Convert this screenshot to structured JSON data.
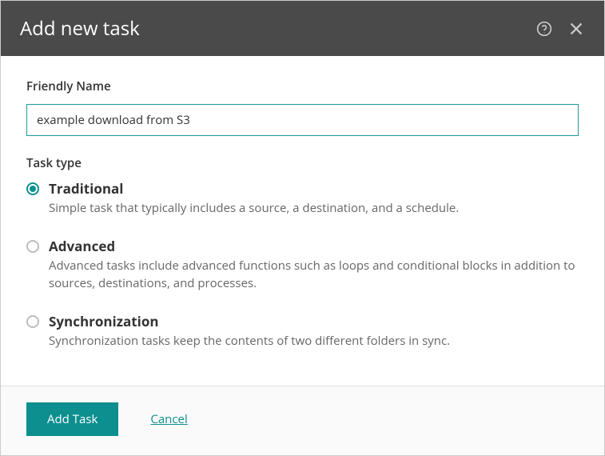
{
  "dialog": {
    "title": "Add new task"
  },
  "form": {
    "friendly_name_label": "Friendly Name",
    "friendly_name_value": "example download from S3",
    "task_type_label": "Task type",
    "options": [
      {
        "title": "Traditional",
        "desc": "Simple task that typically includes a source, a destination, and a schedule.",
        "selected": true
      },
      {
        "title": "Advanced",
        "desc": "Advanced tasks include advanced functions such as loops and conditional blocks in addition to sources, destinations, and processes.",
        "selected": false
      },
      {
        "title": "Synchronization",
        "desc": "Synchronization tasks keep the contents of two different folders in sync.",
        "selected": false
      }
    ]
  },
  "footer": {
    "add_task_label": "Add Task",
    "cancel_label": "Cancel"
  }
}
